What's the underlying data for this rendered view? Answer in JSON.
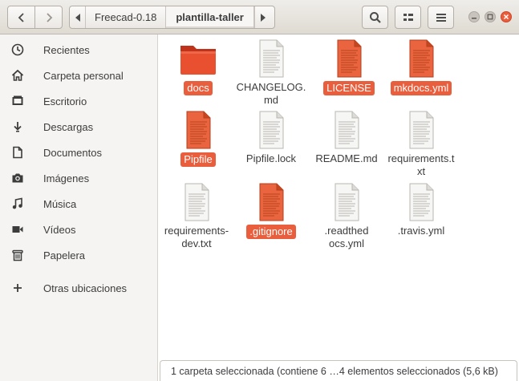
{
  "window": {
    "path": [
      "Freecad-0.18",
      "plantilla-taller"
    ]
  },
  "sidebar": {
    "items": [
      {
        "label": "Recientes",
        "icon": "clock-icon"
      },
      {
        "label": "Carpeta personal",
        "icon": "home-icon"
      },
      {
        "label": "Escritorio",
        "icon": "desktop-icon"
      },
      {
        "label": "Descargas",
        "icon": "download-icon"
      },
      {
        "label": "Documentos",
        "icon": "document-icon"
      },
      {
        "label": "Imágenes",
        "icon": "camera-icon"
      },
      {
        "label": "Música",
        "icon": "music-icon"
      },
      {
        "label": "Vídeos",
        "icon": "video-icon"
      },
      {
        "label": "Papelera",
        "icon": "trash-icon"
      },
      {
        "label": "Otras ubicaciones",
        "icon": "plus-icon"
      }
    ]
  },
  "files": [
    {
      "name": "docs",
      "type": "folder",
      "selected": true
    },
    {
      "name": "CHANGELOG.md",
      "type": "text",
      "selected": false
    },
    {
      "name": "LICENSE",
      "type": "text",
      "selected": true
    },
    {
      "name": "mkdocs.yml",
      "type": "text",
      "selected": true
    },
    {
      "name": "Pipfile",
      "type": "text",
      "selected": true
    },
    {
      "name": "Pipfile.lock",
      "type": "text",
      "selected": false
    },
    {
      "name": "README.md",
      "type": "text",
      "selected": false
    },
    {
      "name": "requirements.txt",
      "type": "text",
      "selected": false
    },
    {
      "name": "requirements-dev.txt",
      "type": "text",
      "selected": false
    },
    {
      "name": ".gitignore",
      "type": "text",
      "selected": true
    },
    {
      "name": ".readthedocs.yml",
      "type": "text",
      "selected": false
    },
    {
      "name": ".travis.yml",
      "type": "text",
      "selected": false
    }
  ],
  "status": {
    "text": "1 carpeta seleccionada (contiene 6 …4 elementos seleccionados (5,6 kB)"
  },
  "colors": {
    "selection": "#e95e3c",
    "close_button": "#e95e3c"
  }
}
